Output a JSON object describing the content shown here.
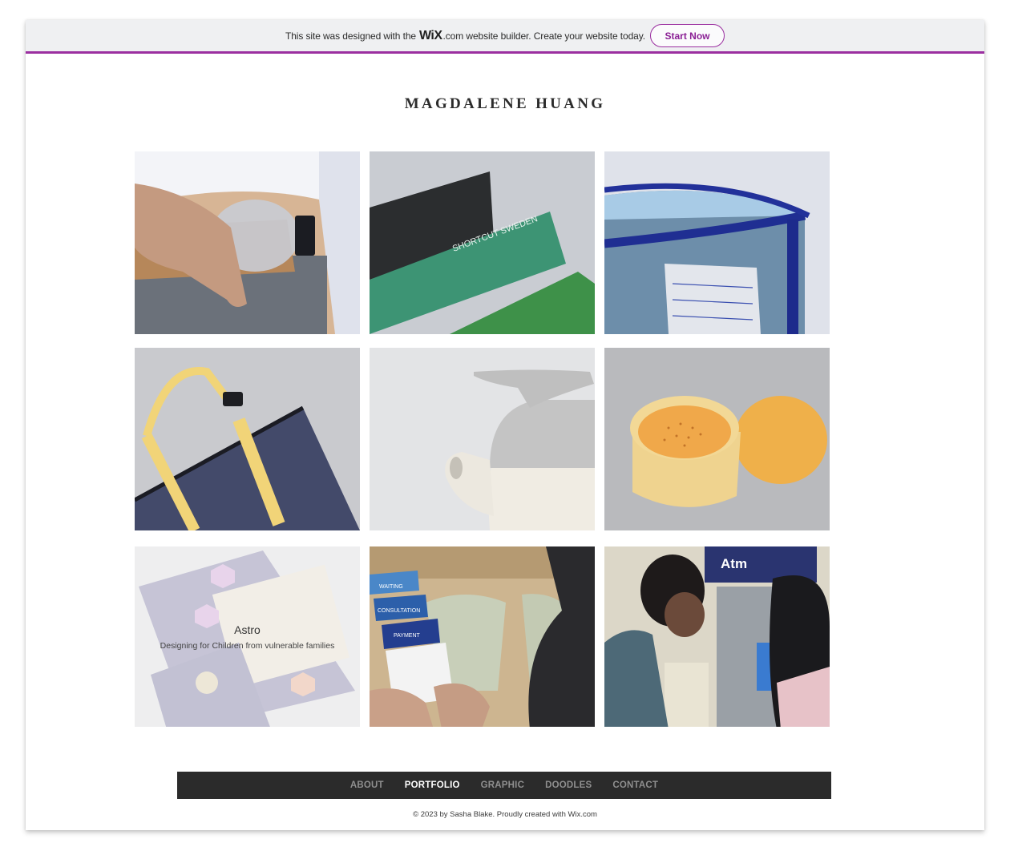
{
  "banner": {
    "text_before": "This site was designed with the",
    "logo": "WiX",
    "text_after": ".com website builder. Create your website today.",
    "cta": "Start Now",
    "accent_color": "#9b2fa0"
  },
  "site": {
    "title": "MAGDALENE HUANG"
  },
  "gallery": {
    "items": [
      {
        "alt": "ostomy-bag-on-waist-photo"
      },
      {
        "alt": "shortcut-sweden-boxes-photo",
        "label": "SHORTCUT SWEDEN"
      },
      {
        "alt": "blue-urine-bag-holder-photo"
      },
      {
        "alt": "navy-tote-bag-yellow-strap-photo"
      },
      {
        "alt": "white-kettle-photo"
      },
      {
        "alt": "yellow-steamer-container-photo"
      },
      {
        "alt": "astro-board-game-photo",
        "title": "Astro",
        "subtitle": "Designing for Children from vulnerable families"
      },
      {
        "alt": "clinic-queue-cards-photo",
        "labels": [
          "WAITING",
          "CONSULTATION",
          "PAYMENT"
        ]
      },
      {
        "alt": "atm-users-photo",
        "label": "Atm"
      }
    ]
  },
  "footer": {
    "nav": [
      "ABOUT",
      "PORTFOLIO",
      "GRAPHIC",
      "DOODLES",
      "CONTACT"
    ],
    "active": "PORTFOLIO",
    "copyright": "© 2023 by Sasha Blake. Proudly created with Wix.com"
  }
}
